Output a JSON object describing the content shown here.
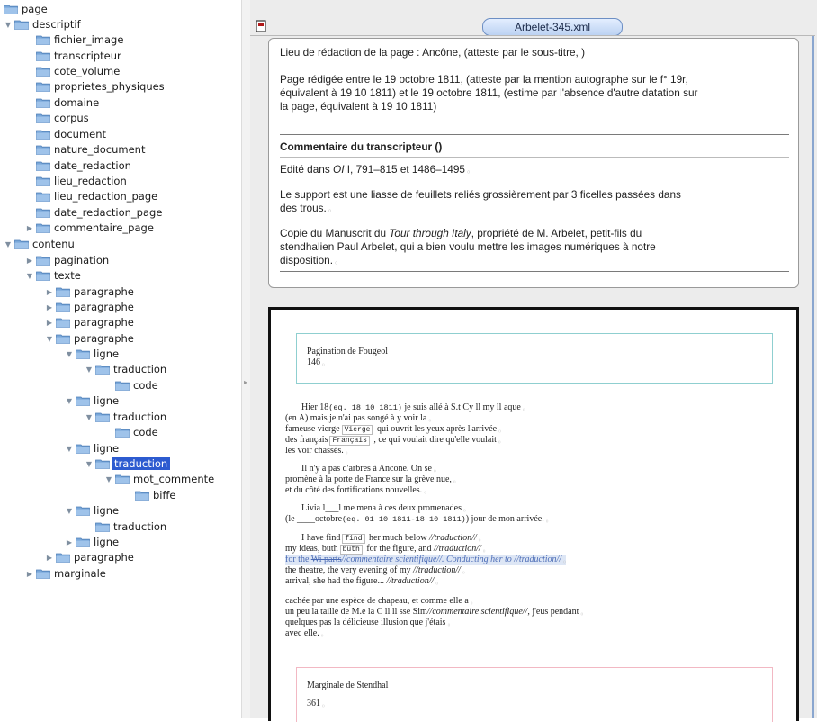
{
  "tree": {
    "nodes": [
      {
        "label": "page",
        "toggle": ""
      },
      {
        "label": "descriptif",
        "toggle": "▼"
      },
      {
        "label": "fichier_image",
        "toggle": ""
      },
      {
        "label": "transcripteur",
        "toggle": ""
      },
      {
        "label": "cote_volume",
        "toggle": ""
      },
      {
        "label": "proprietes_physiques",
        "toggle": ""
      },
      {
        "label": "domaine",
        "toggle": ""
      },
      {
        "label": "corpus",
        "toggle": ""
      },
      {
        "label": "document",
        "toggle": ""
      },
      {
        "label": "nature_document",
        "toggle": ""
      },
      {
        "label": "date_redaction",
        "toggle": ""
      },
      {
        "label": "lieu_redaction",
        "toggle": ""
      },
      {
        "label": "lieu_redaction_page",
        "toggle": ""
      },
      {
        "label": "date_redaction_page",
        "toggle": ""
      },
      {
        "label": "commentaire_page",
        "toggle": "▶"
      },
      {
        "label": "contenu",
        "toggle": "▼"
      },
      {
        "label": "pagination",
        "toggle": "▶"
      },
      {
        "label": "texte",
        "toggle": "▼"
      },
      {
        "label": "paragraphe",
        "toggle": "▶"
      },
      {
        "label": "paragraphe",
        "toggle": "▶"
      },
      {
        "label": "paragraphe",
        "toggle": "▶"
      },
      {
        "label": "paragraphe",
        "toggle": "▼"
      },
      {
        "label": "ligne",
        "toggle": "▼"
      },
      {
        "label": "traduction",
        "toggle": "▼"
      },
      {
        "label": "code",
        "toggle": ""
      },
      {
        "label": "ligne",
        "toggle": "▼"
      },
      {
        "label": "traduction",
        "toggle": "▼"
      },
      {
        "label": "code",
        "toggle": ""
      },
      {
        "label": "ligne",
        "toggle": "▼"
      },
      {
        "label": "traduction",
        "toggle": "▼",
        "selected": true
      },
      {
        "label": "mot_commente",
        "toggle": "▼"
      },
      {
        "label": "biffe",
        "toggle": ""
      },
      {
        "label": "ligne",
        "toggle": "▼"
      },
      {
        "label": "traduction",
        "toggle": ""
      },
      {
        "label": "ligne",
        "toggle": "▶"
      },
      {
        "label": "paragraphe",
        "toggle": "▶"
      },
      {
        "label": "marginale",
        "toggle": "▶"
      }
    ]
  },
  "editor": {
    "tab_title": "Arbelet-345.xml"
  },
  "header": {
    "lieu": "Lieu de rédaction de la page : Ancône, (atteste par le sous-titre, )",
    "date_l1": "Page rédigée entre le 19 octobre 1811, (atteste par la mention autographe sur le f° 19r,",
    "date_l2": "équivalent à 19 10 1811) et le 19 octobre 1811, (estime par l'absence d'autre datation sur",
    "date_l3": "la page, équivalent à 19 10 1811)",
    "comment_title": "Commentaire du transcripteur ()",
    "edite": "Edité dans ",
    "edite_ital": "OI",
    "edite_rest": " I, 791–815 et 1486–1495",
    "support_l1": "Le support est une liasse de feuillets reliés grossièrement par 3 ficelles passées dans",
    "support_l2": "des trous.",
    "copie_l1a": "Copie du Manuscrit du ",
    "copie_l1b": "Tour through Italy",
    "copie_l1c": ", propriété de M. Arbelet, petit-fils du",
    "copie_l2": "stendhalien Paul Arbelet, qui a bien voulu mettre les images numériques à notre",
    "copie_l3": "disposition.",
    "marker": "₀"
  },
  "transcription": {
    "pagination_label": "Pagination de Fougeol",
    "pagination_value": "146",
    "p1": {
      "l1a": "Hier 18",
      "l1b": "(eq. 18 10 1811)",
      "l1c": " je suis allé à S.t Cy ll my ll aque",
      "l2": "(en A) mais je n'ai pas songé à y voir la",
      "l3a": "fameuse vierge",
      "l3b": "Vierge",
      "l3c": " qui ouvrit les yeux après l'arrivée",
      "l4a": "des français",
      "l4b": "Français",
      "l4c": " , ce qui voulait dire qu'elle voulait",
      "l5": "les voir chassés."
    },
    "p2": {
      "l1": "Il n'y a pas d'arbres à Ancone. On se",
      "l2": "promène à la porte de France sur la grève nue,",
      "l3": "et du côté des fortifications nouvelles."
    },
    "p3": {
      "l1": "Livia l___l me mena à ces deux promenades",
      "l2a": "(le ____octobre",
      "l2b": "(eq. 01 10 1811-18 10 1811)",
      "l2c": ") jour de mon arrivée."
    },
    "p4": {
      "l1a": "I have find",
      "l1b": "find",
      "l1c": " her much below ",
      "l1d": "//traduction//",
      "l2a": "my ideas, buth",
      "l2b": "buth",
      "l2c": " for the figure, and ",
      "l2d": "//traduction//",
      "l3a": "for the ",
      "l3b": "Wi parts",
      "l3c": "//commentaire scientifique//. Conducting her to //traduction//",
      "l4a": "the theatre, the very evening of my ",
      "l4b": "//traduction//",
      "l5a": "arrival, she had the figure... ",
      "l5b": "//traduction//"
    },
    "p5": {
      "l1": "cachée par une espèce de chapeau, et comme elle a",
      "l2a": "un peu la taille de M.e la C ll ll sse Sim",
      "l2b": "//commentaire scientifique//",
      "l2c": ", j'eus pendant",
      "l3": "quelques pas la délicieuse illusion que j'étais",
      "l4": "avec elle."
    },
    "marginale_label": "Marginale de Stendhal",
    "marginale_value": "361"
  }
}
